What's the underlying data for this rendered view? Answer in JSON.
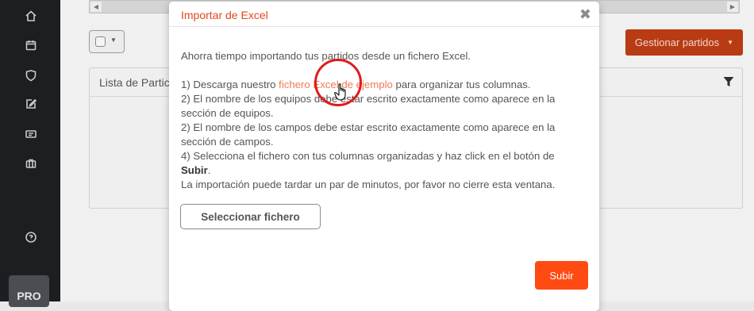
{
  "sidebar": {
    "icons": [
      "home-icon",
      "calendar-icon",
      "shield-icon",
      "edit-icon",
      "id-card-icon",
      "briefcase-icon",
      "help-icon"
    ],
    "pro_label": "PRO"
  },
  "background": {
    "manage_button_label": "Gestionar partidos",
    "panel_title": "Lista de Partic"
  },
  "modal": {
    "title": "Importar de Excel",
    "intro": "Ahorra tiempo importando tus partidos desde un fichero Excel.",
    "step1_prefix": "1) Descarga nuestro ",
    "step1_link": "fichero Excel de ejemplo",
    "step1_suffix": " para organizar tus columnas.",
    "step2a": "2) El nombre de los equipos debe estar escrito exactamente como aparece en la sección de equipos.",
    "step2b": "2) El nombre de los campos debe estar escrito exactamente como aparece en la sección de campos.",
    "step4_prefix": "4) Selecciona el fichero con tus columnas organizadas y haz click en el botón de ",
    "step4_bold": "Subir",
    "step4_suffix": ".",
    "note": "La importación puede tardar un par de minutos, por favor no cierre esta ventana.",
    "select_file_label": "Seleccionar fichero",
    "submit_label": "Subir"
  },
  "colors": {
    "accent": "#ff4a12",
    "title": "#e0481e",
    "link": "#f07a55",
    "sidebar_bg": "#1c1e21"
  }
}
